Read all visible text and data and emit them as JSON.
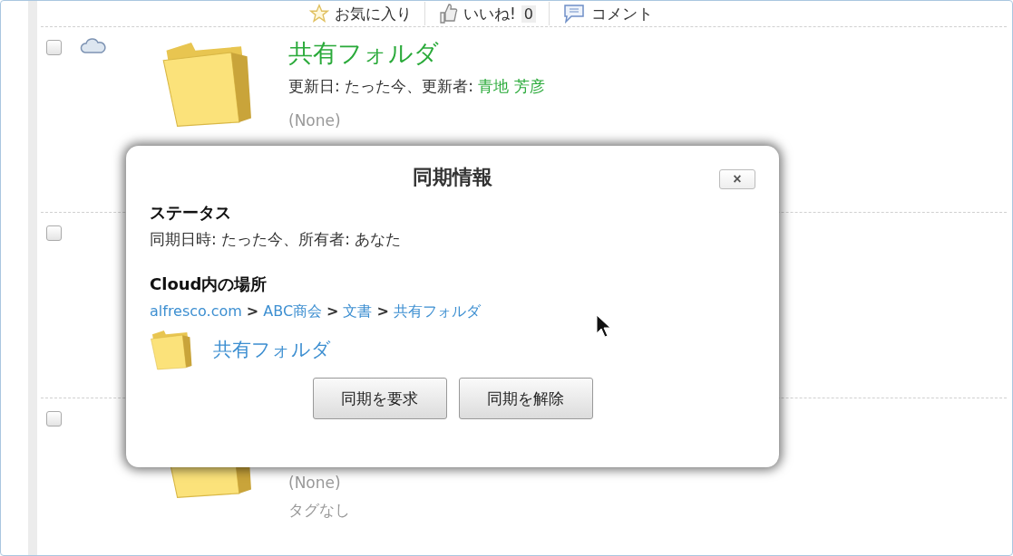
{
  "actions": [
    {
      "kind": "favorite",
      "label": "お気に入り"
    },
    {
      "kind": "like",
      "label": "いいね!",
      "count": "0"
    },
    {
      "kind": "comment",
      "label": "コメント"
    }
  ],
  "rows": [
    {
      "checked": false,
      "synced": true,
      "folder": true,
      "title": "共有フォルダ",
      "meta": "更新日: たった今、更新者: ",
      "user": "青地 芳彦",
      "description": "(None)"
    },
    {
      "checked": false,
      "synced": false
    },
    {
      "checked": false,
      "synced": false,
      "folder": true,
      "description": "(None)",
      "tags": "タグなし"
    }
  ],
  "dialog": {
    "title": "同期情報",
    "close": "×",
    "status_heading": "ステータス",
    "status_text": "同期日時: たった今、所有者: あなた",
    "location_heading": "Cloud内の場所",
    "breadcrumb": [
      {
        "kind": "link",
        "label": "alfresco.com"
      },
      {
        "kind": "separator",
        "label": ">"
      },
      {
        "kind": "link",
        "label": "ABC商会"
      },
      {
        "kind": "separator",
        "label": ">"
      },
      {
        "kind": "link",
        "label": "文書"
      },
      {
        "kind": "separator",
        "label": ">"
      },
      {
        "kind": "link",
        "label": "共有フォルダ"
      }
    ],
    "folder_link": "共有フォルダ",
    "buttons": [
      "同期を要求",
      "同期を解除"
    ]
  }
}
